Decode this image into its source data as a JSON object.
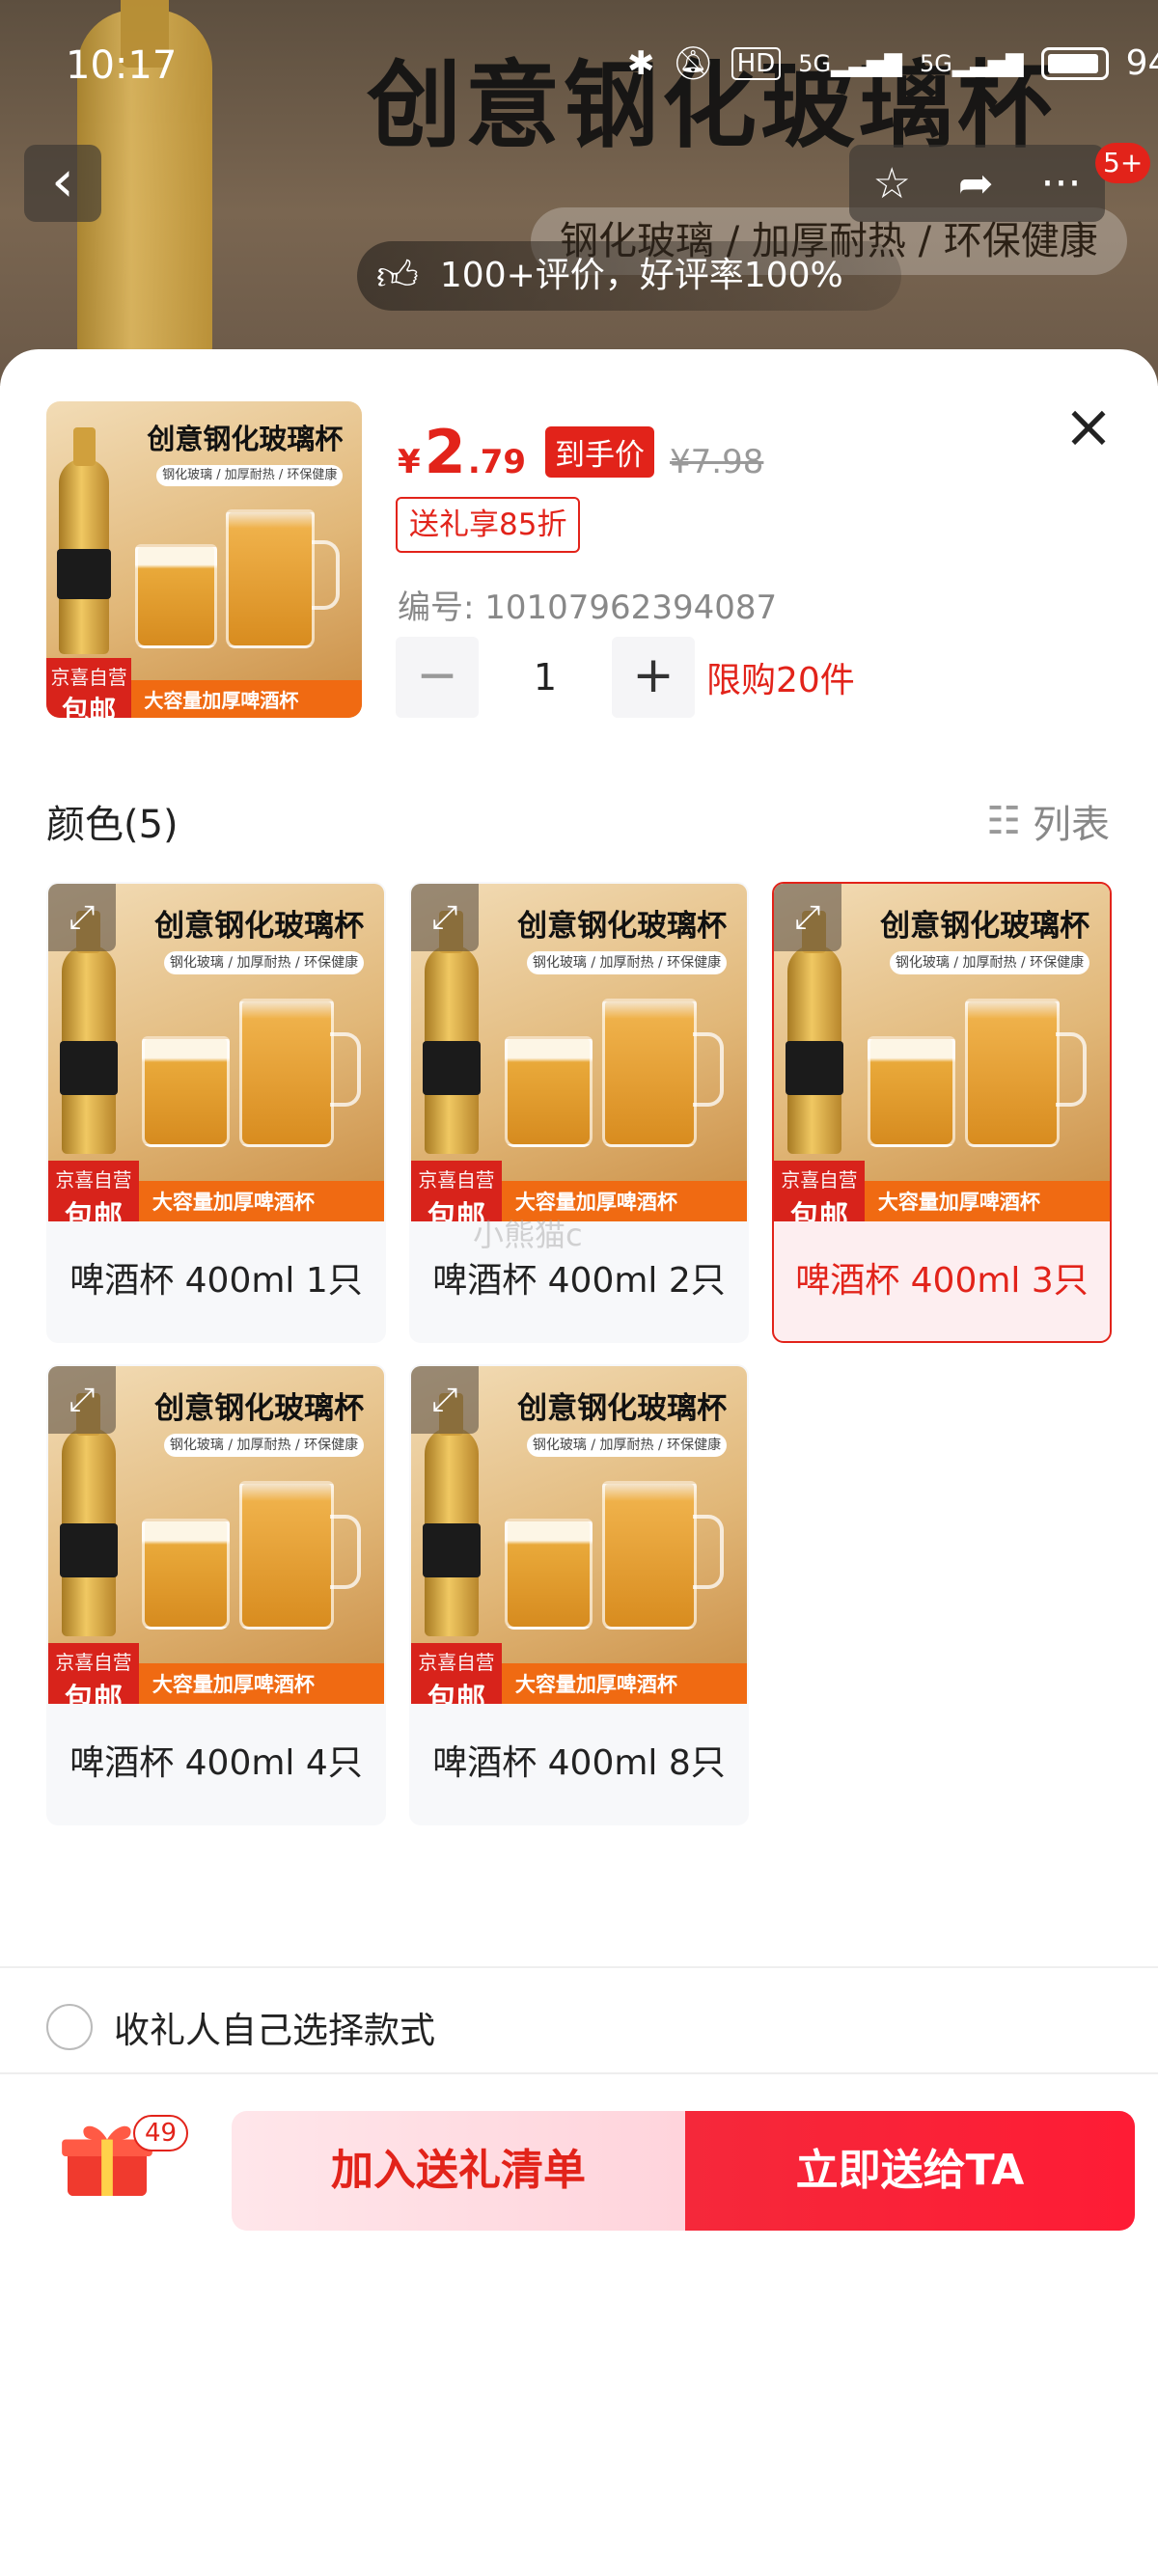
{
  "status_bar": {
    "time": "10:17",
    "network": "5G",
    "network2": "5G",
    "hd": "HD",
    "battery": "94%"
  },
  "backdrop": {
    "product_title": "创意钢化玻璃杯",
    "product_tags": "钢化玻璃 / 加厚耐热 / 环保健康",
    "review_summary": "100+评价，好评率100%",
    "cart_badge": "5+"
  },
  "product_image": {
    "title": "创意钢化玻璃杯",
    "tags": "钢化玻璃 / 加厚耐热 / 环保健康",
    "badge_line1": "京喜自营",
    "badge_line2": "包邮",
    "banner": "大容量加厚啤酒杯"
  },
  "sheet": {
    "price_symbol": "¥",
    "price_int": "2",
    "price_dec": ".79",
    "price_tag": "到手价",
    "original_price": "¥7.98",
    "gift_discount": "送礼享85折",
    "sku": "编号: 10107962394087",
    "qty_minus": "−",
    "quantity": "1",
    "qty_plus": "+",
    "limit": "限购20件",
    "color_header": "颜色(5)",
    "list_toggle": "列表",
    "close": "×"
  },
  "options": [
    {
      "label": "啤酒杯 400ml 1只",
      "selected": false
    },
    {
      "label": "啤酒杯 400ml 2只",
      "selected": false
    },
    {
      "label": "啤酒杯 400ml 3只",
      "selected": true
    },
    {
      "label": "啤酒杯 400ml 4只",
      "selected": false
    },
    {
      "label": "啤酒杯 400ml 8只",
      "selected": false
    }
  ],
  "watermark": "小熊猫c",
  "recipient_option": "收礼人自己选择款式",
  "bottom": {
    "gift_count": "49",
    "add_button": "加入送礼清单",
    "send_button": "立即送给TA"
  },
  "colors": {
    "accent": "#e2231a",
    "orange": "#f06a12",
    "selected_bg": "#fdeef0"
  }
}
